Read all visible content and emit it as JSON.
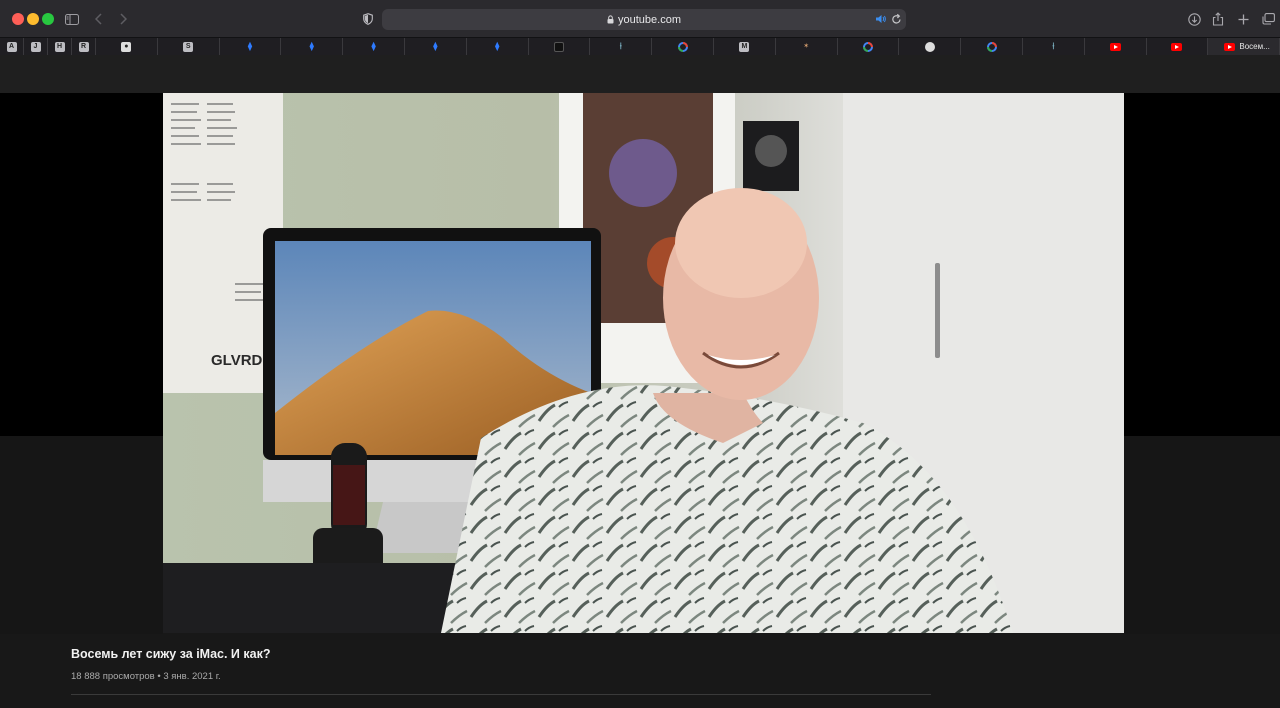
{
  "browser": {
    "address": "youtube.com",
    "tabs": [
      {
        "fav": "A",
        "type": "letter"
      },
      {
        "fav": "J",
        "type": "letter"
      },
      {
        "fav": "H",
        "type": "letter"
      },
      {
        "fav": "R",
        "type": "letter"
      },
      {
        "fav": "apple-icon",
        "type": "apple"
      },
      {
        "fav": "S",
        "type": "letter"
      },
      {
        "fav": "jira-icon",
        "type": "jira"
      },
      {
        "fav": "jira-icon",
        "type": "jira"
      },
      {
        "fav": "jira-icon",
        "type": "jira"
      },
      {
        "fav": "jira-icon",
        "type": "jira"
      },
      {
        "fav": "jira-icon",
        "type": "jira"
      },
      {
        "fav": "dark-square-icon",
        "type": "dark"
      },
      {
        "fav": "pin-icon",
        "type": "pin"
      },
      {
        "fav": "google-icon",
        "type": "google"
      },
      {
        "fav": "M",
        "type": "letter"
      },
      {
        "fav": "figure-icon",
        "type": "figure"
      },
      {
        "fav": "google-icon",
        "type": "google"
      },
      {
        "fav": "circle-icon",
        "type": "circle"
      },
      {
        "fav": "google-icon",
        "type": "google"
      },
      {
        "fav": "pin-icon",
        "type": "pin"
      },
      {
        "fav": "youtube-icon",
        "type": "yt"
      },
      {
        "fav": "youtube-icon",
        "type": "yt"
      }
    ],
    "active_tab_label": "Восем..."
  },
  "video": {
    "title": "Восемь лет сижу за iMac. И как?",
    "meta": "18 888 просмотров • 3 янв. 2021 г.",
    "poster_text": "GLVRD.R"
  },
  "colors": {
    "chrome_bg": "#2b2a2e",
    "page_bg": "#181818",
    "youtube_red": "#ff0000"
  }
}
